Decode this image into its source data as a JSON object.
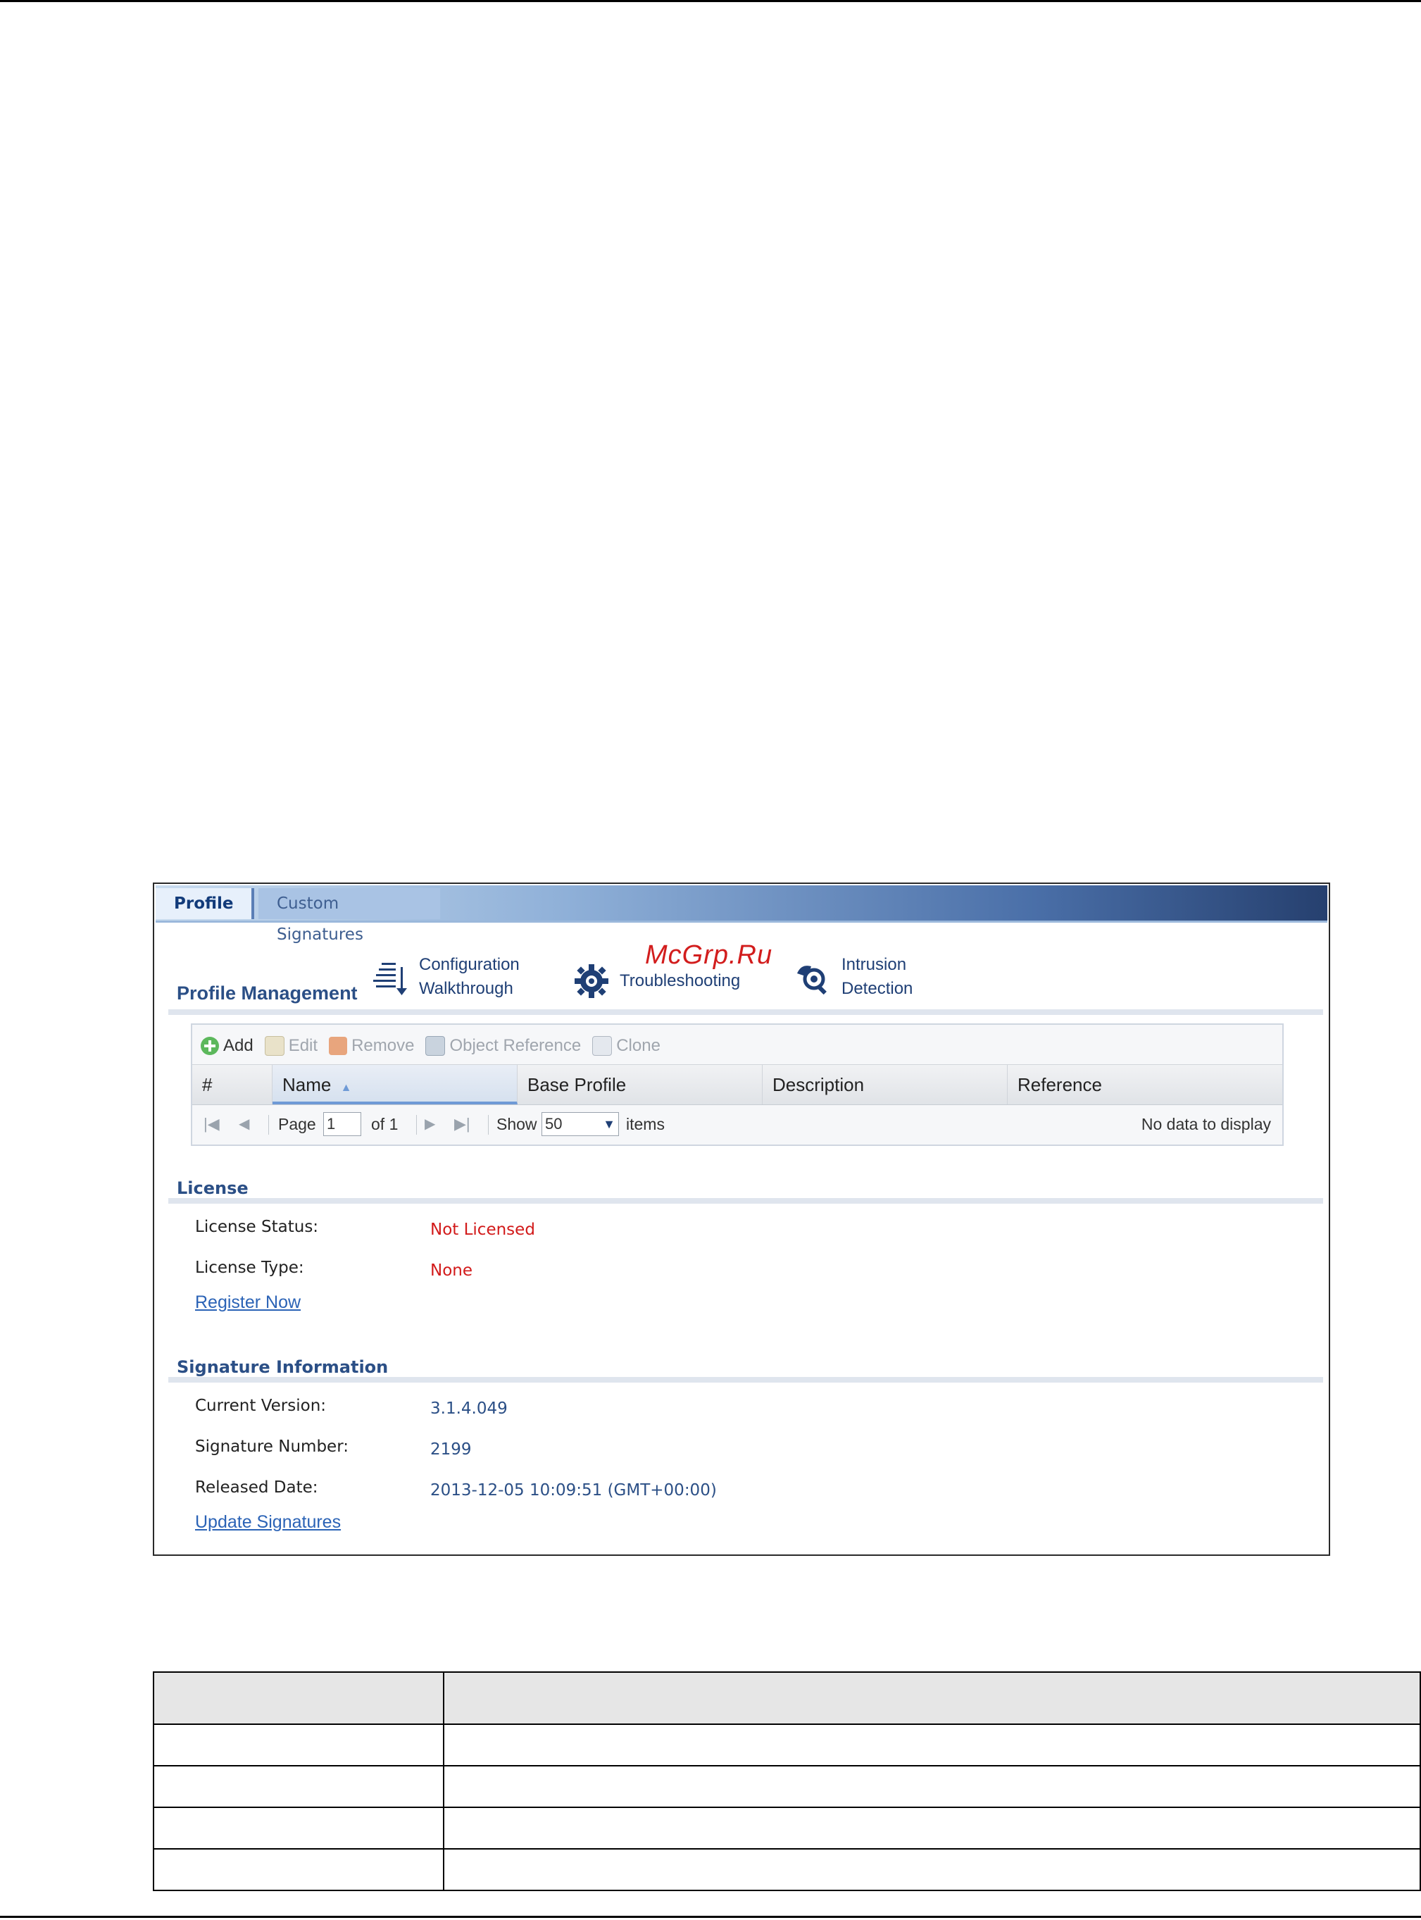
{
  "tabs": [
    {
      "label": "Profile",
      "active": true
    },
    {
      "label": "Custom Signatures",
      "active": false
    }
  ],
  "profile_management": {
    "title": "Profile Management",
    "quick_links": [
      {
        "icon": "walkthrough-icon",
        "line1": "Configuration",
        "line2": "Walkthrough"
      },
      {
        "icon": "troubleshooting-gear-icon",
        "line1": "Troubleshooting",
        "line2": ""
      },
      {
        "icon": "intrusion-detection-icon",
        "line1": "Intrusion",
        "line2": "Detection"
      }
    ],
    "toolbar": {
      "add": "Add",
      "edit": "Edit",
      "remove": "Remove",
      "object_reference": "Object Reference",
      "clone": "Clone"
    },
    "columns": [
      "#",
      "Name",
      "Base Profile",
      "Description",
      "Reference"
    ],
    "sorted_column": "Name",
    "pager": {
      "page_label": "Page",
      "page_value": "1",
      "of_label": "of 1",
      "show_label": "Show",
      "show_value": "50",
      "items_label": "items",
      "empty_text": "No data to display"
    }
  },
  "license": {
    "title": "License",
    "status_label": "License Status:",
    "status_value": "Not Licensed",
    "type_label": "License Type:",
    "type_value": "None",
    "register_link": "Register Now"
  },
  "signature_info": {
    "title": "Signature Information",
    "current_version_label": "Current Version:",
    "current_version_value": "3.1.4.049",
    "signature_number_label": "Signature Number:",
    "signature_number_value": "2199",
    "released_date_label": "Released Date:",
    "released_date_value": "2013-12-05 10:09:51 (GMT+00:00)",
    "update_link": "Update Signatures"
  },
  "watermark": "McGrp.Ru",
  "colors": {
    "accent_blue": "#2b4f86",
    "status_red": "#d21a1a",
    "link_blue": "#2b63b6"
  }
}
